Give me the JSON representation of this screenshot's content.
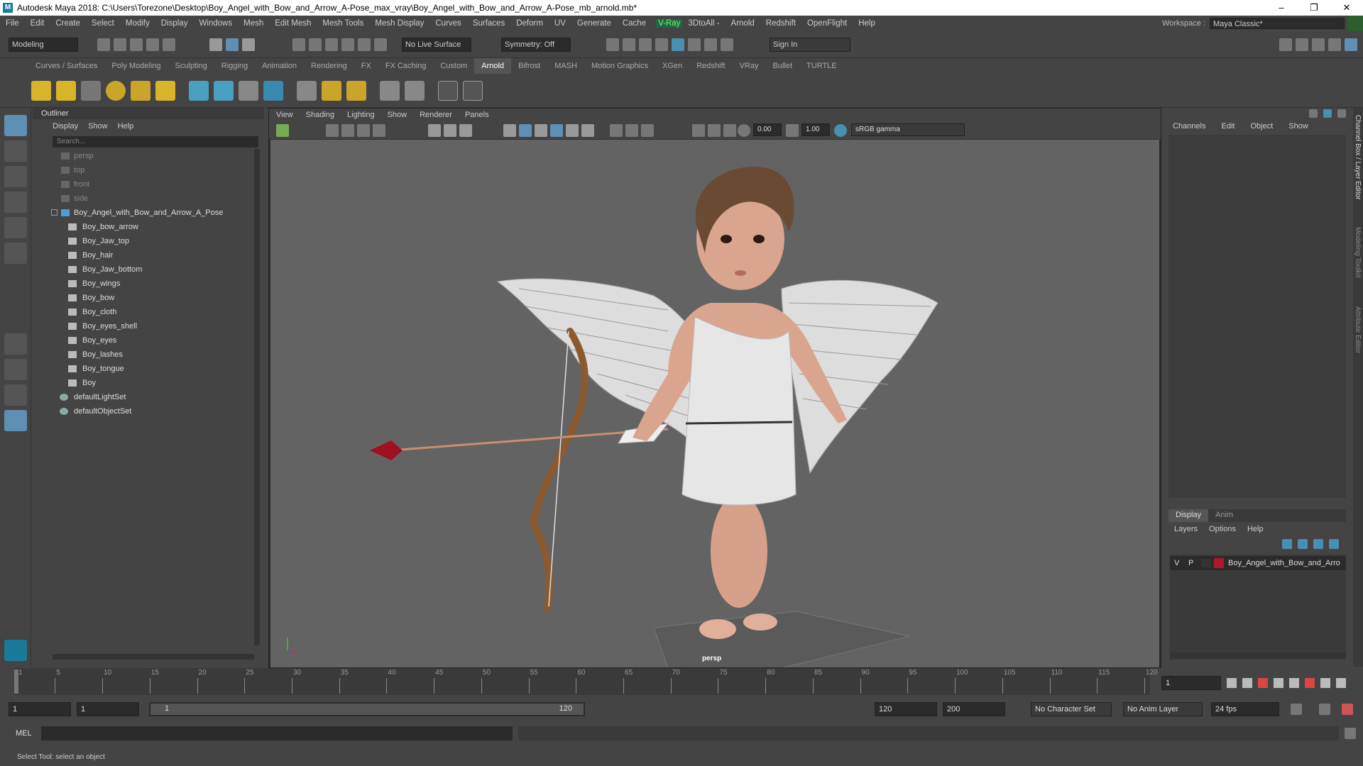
{
  "window": {
    "title": "Autodesk Maya 2018: C:\\Users\\Torezone\\Desktop\\Boy_Angel_with_Bow_and_Arrow_A-Pose_max_vray\\Boy_Angel_with_Bow_and_Arrow_A-Pose_mb_arnold.mb*",
    "minimize": "–",
    "maximize": "❐",
    "close": "✕"
  },
  "menubar": {
    "items": [
      "File",
      "Edit",
      "Create",
      "Select",
      "Modify",
      "Display",
      "Windows",
      "Mesh",
      "Edit Mesh",
      "Mesh Tools",
      "Mesh Display",
      "Curves",
      "Surfaces",
      "Deform",
      "UV",
      "Generate",
      "Cache"
    ],
    "vray": "V-Ray",
    "items2": [
      "3DtoAll -",
      "Arnold",
      "Redshift",
      "OpenFlight",
      "Help"
    ],
    "workspace_label": "Workspace :",
    "workspace_value": "Maya Classic*"
  },
  "statusline": {
    "mode": "Modeling",
    "live_surface": "No Live Surface",
    "symmetry": "Symmetry: Off",
    "sign_in": "Sign In"
  },
  "shelf": {
    "tabs": [
      "Curves / Surfaces",
      "Poly Modeling",
      "Sculpting",
      "Rigging",
      "Animation",
      "Rendering",
      "FX",
      "FX Caching",
      "Custom",
      "Arnold",
      "Bifrost",
      "MASH",
      "Motion Graphics",
      "XGen",
      "Redshift",
      "VRay",
      "Bullet",
      "TURTLE"
    ],
    "active_tab": "Arnold"
  },
  "outliner": {
    "title": "Outliner",
    "menu": [
      "Display",
      "Show",
      "Help"
    ],
    "search_placeholder": "Search...",
    "cameras": [
      "persp",
      "top",
      "front",
      "side"
    ],
    "root": "Boy_Angel_with_Bow_and_Arrow_A_Pose",
    "children": [
      "Boy_bow_arrow",
      "Boy_Jaw_top",
      "Boy_hair",
      "Boy_Jaw_bottom",
      "Boy_wings",
      "Boy_bow",
      "Boy_cloth",
      "Boy_eyes_shell",
      "Boy_eyes",
      "Boy_lashes",
      "Boy_tongue",
      "Boy"
    ],
    "sets": [
      "defaultLightSet",
      "defaultObjectSet"
    ]
  },
  "viewport": {
    "menu": [
      "View",
      "Shading",
      "Lighting",
      "Show",
      "Renderer",
      "Panels"
    ],
    "exposure": "0.00",
    "gamma": "1.00",
    "colorspace": "sRGB gamma",
    "camera_label": "persp"
  },
  "channelbox": {
    "menu": [
      "Channels",
      "Edit",
      "Object",
      "Show"
    ],
    "side_tabs": [
      "Channel Box / Layer Editor",
      "Modeling Toolkit",
      "Attribute Editor"
    ],
    "layer_tabs": [
      "Display",
      "Anim"
    ],
    "layer_menu": [
      "Layers",
      "Options",
      "Help"
    ],
    "layer_v": "V",
    "layer_p": "P",
    "layer_name": "Boy_Angel_with_Bow_and_Arro",
    "layer_color": "#b0162d"
  },
  "timeline": {
    "ticks": [
      "1",
      "5",
      "10",
      "15",
      "20",
      "25",
      "30",
      "35",
      "40",
      "45",
      "50",
      "55",
      "60",
      "65",
      "70",
      "75",
      "80",
      "85",
      "90",
      "95",
      "100",
      "105",
      "110",
      "115",
      "120"
    ],
    "current_frame": "1"
  },
  "range": {
    "start": "1",
    "playback_start": "1",
    "slider_start": "1",
    "slider_end": "120",
    "playback_end": "120",
    "end": "200",
    "character_set": "No Character Set",
    "anim_layer": "No Anim Layer",
    "fps": "24 fps"
  },
  "cmd": {
    "label": "MEL"
  },
  "help": {
    "text": "Select Tool: select an object"
  }
}
